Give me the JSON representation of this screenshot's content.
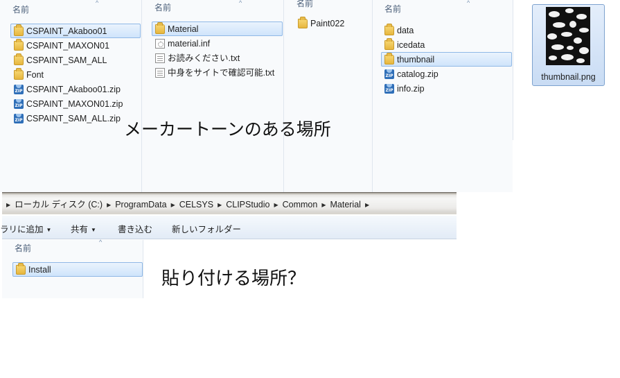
{
  "columns": {
    "col1": {
      "header": "名前",
      "items": [
        {
          "label": "CSPAINT_Akaboo01",
          "icon": "folder-icon",
          "selected": true
        },
        {
          "label": "CSPAINT_MAXON01",
          "icon": "folder-icon"
        },
        {
          "label": "CSPAINT_SAM_ALL",
          "icon": "folder-icon"
        },
        {
          "label": "Font",
          "icon": "folder-icon"
        },
        {
          "label": "CSPAINT_Akaboo01.zip",
          "icon": "zip-icon"
        },
        {
          "label": "CSPAINT_MAXON01.zip",
          "icon": "zip-icon"
        },
        {
          "label": "CSPAINT_SAM_ALL.zip",
          "icon": "zip-icon"
        }
      ]
    },
    "col2": {
      "header": "名前",
      "items": [
        {
          "label": "Material",
          "icon": "folder-icon",
          "selected": true
        },
        {
          "label": "material.inf",
          "icon": "inf-file-icon"
        },
        {
          "label": "お読みください.txt",
          "icon": "text-file-icon"
        },
        {
          "label": "中身をサイトで確認可能.txt",
          "icon": "text-file-icon"
        }
      ]
    },
    "col3": {
      "header": "名前",
      "items": [
        {
          "label": "Paint022",
          "icon": "folder-icon"
        }
      ]
    },
    "col4": {
      "header": "名前",
      "items": [
        {
          "label": "data",
          "icon": "folder-icon"
        },
        {
          "label": "icedata",
          "icon": "folder-icon"
        },
        {
          "label": "thumbnail",
          "icon": "folder-icon",
          "selected": true
        },
        {
          "label": "catalog.zip",
          "icon": "zip-icon"
        },
        {
          "label": "info.zip",
          "icon": "zip-icon"
        }
      ]
    },
    "col5": {
      "thumbnail_label": "thumbnail.png",
      "thumbnail_icon": "image-thumbnail-icon"
    }
  },
  "annotations": {
    "upper": "メーカートーンのある場所",
    "lower": "貼り付ける場所？"
  },
  "breadcrumb": [
    "ローカル ディスク (C:)",
    "ProgramData",
    "CELSYS",
    "CLIPStudio",
    "Common",
    "Material"
  ],
  "toolbar": {
    "library": "ラリに追加",
    "share": "共有",
    "burn": "書き込む",
    "new_folder": "新しいフォルダー"
  },
  "lower_nav": {
    "header": "名前",
    "items": [
      {
        "label": "Install",
        "icon": "folder-icon",
        "selected": true
      }
    ]
  },
  "colors": {
    "selection": "#cfe4fb",
    "selection_border": "#8fb8e6",
    "header_text": "#4c607a"
  }
}
